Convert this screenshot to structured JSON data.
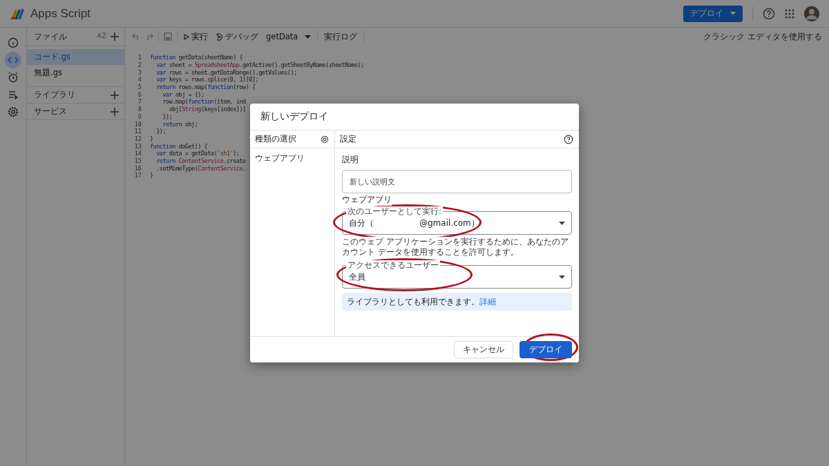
{
  "header": {
    "app_title": "Apps Script",
    "deploy_button": "デプロイ"
  },
  "rail": [
    {
      "kind": "info",
      "selected": false
    },
    {
      "kind": "code",
      "selected": true
    },
    {
      "kind": "clock",
      "selected": false
    },
    {
      "kind": "runs",
      "selected": false
    },
    {
      "kind": "settings",
      "selected": false
    }
  ],
  "files_panel": {
    "title": "ファイル",
    "files": [
      {
        "name": "コード.gs",
        "selected": true
      },
      {
        "name": "無題.gs",
        "selected": false
      }
    ],
    "sections": [
      "ライブラリ",
      "サービス"
    ]
  },
  "toolbar": {
    "run": "実行",
    "debug": "デバッグ",
    "function": "getData",
    "log": "実行ログ",
    "classic_link": "クラシック エディタを使用する"
  },
  "code_lines": [
    [
      {
        "kind": "kw",
        "text": "function"
      },
      {
        "kind": "plain",
        "text": " getData(sheetName) {"
      }
    ],
    [
      {
        "kind": "kw",
        "text": "  var"
      },
      {
        "kind": "plain",
        "text": " sheet = "
      },
      {
        "kind": "cls",
        "text": "SpreadsheetApp"
      },
      {
        "kind": "plain",
        "text": ".getActive().getSheetByName(sheetName);"
      }
    ],
    [
      {
        "kind": "kw",
        "text": "  var"
      },
      {
        "kind": "plain",
        "text": " rows = sheet.getDataRange().getValues();"
      }
    ],
    [
      {
        "kind": "kw",
        "text": "  var"
      },
      {
        "kind": "plain",
        "text": " keys = rows.splice(0, 1)[0];"
      }
    ],
    [
      {
        "kind": "kw",
        "text": "  return"
      },
      {
        "kind": "plain",
        "text": " rows.map("
      },
      {
        "kind": "kw",
        "text": "function"
      },
      {
        "kind": "plain",
        "text": "(row) {"
      }
    ],
    [
      {
        "kind": "kw",
        "text": "    var"
      },
      {
        "kind": "plain",
        "text": " obj = {};"
      }
    ],
    [
      {
        "kind": "plain",
        "text": "    row.map("
      },
      {
        "kind": "kw",
        "text": "function"
      },
      {
        "kind": "plain",
        "text": "(item, ind"
      }
    ],
    [
      {
        "kind": "plain",
        "text": "      obj["
      },
      {
        "kind": "cls",
        "text": "String"
      },
      {
        "kind": "plain",
        "text": "(keys[index])]"
      }
    ],
    [
      {
        "kind": "plain",
        "text": "    });"
      }
    ],
    [
      {
        "kind": "kw",
        "text": "    return"
      },
      {
        "kind": "plain",
        "text": " obj;"
      }
    ],
    [
      {
        "kind": "plain",
        "text": "  });"
      }
    ],
    [
      {
        "kind": "plain",
        "text": "}"
      }
    ],
    [
      {
        "kind": "kw",
        "text": "function"
      },
      {
        "kind": "plain",
        "text": " doGet() {"
      }
    ],
    [
      {
        "kind": "kw",
        "text": "  var"
      },
      {
        "kind": "plain",
        "text": " data = getData("
      },
      {
        "kind": "str",
        "text": "'sh1'"
      },
      {
        "kind": "plain",
        "text": ");"
      }
    ],
    [
      {
        "kind": "kw",
        "text": "  return "
      },
      {
        "kind": "cls",
        "text": "ContentService"
      },
      {
        "kind": "plain",
        "text": ".create"
      }
    ],
    [
      {
        "kind": "plain",
        "text": "  .setMimeType("
      },
      {
        "kind": "cls",
        "text": "ContentService"
      },
      {
        "kind": "plain",
        "text": "."
      }
    ],
    [
      {
        "kind": "plain",
        "text": "}"
      }
    ]
  ],
  "line_numbers": [
    "1",
    "2",
    "3",
    "4",
    "5",
    "6",
    "7",
    "8",
    "9",
    "10",
    "11",
    "12",
    "13",
    "14",
    "15",
    "16",
    "17"
  ],
  "dialog": {
    "title": "新しいデプロイ",
    "type_header": "種類の選択",
    "types": [
      {
        "label": "ウェブアプリ",
        "selected": true
      }
    ],
    "settings_header": "設定",
    "description_label": "説明",
    "description_placeholder": "新しい説明文",
    "section_label": "ウェブアプリ",
    "execute_as": {
      "label": "次のユーザーとして実行:",
      "value_prefix": "自分（",
      "value_suffix": "@gmail.com）"
    },
    "execute_note": "このウェブ アプリケーションを実行するために、あなたのアカウント データを使用することを許可します。",
    "access": {
      "label": "アクセスできるユーザー",
      "value": "全員"
    },
    "info_text": "ライブラリとしても利用できます。",
    "info_link": "詳細",
    "cancel_button": "キャンセル",
    "deploy_button": "デプロイ"
  }
}
